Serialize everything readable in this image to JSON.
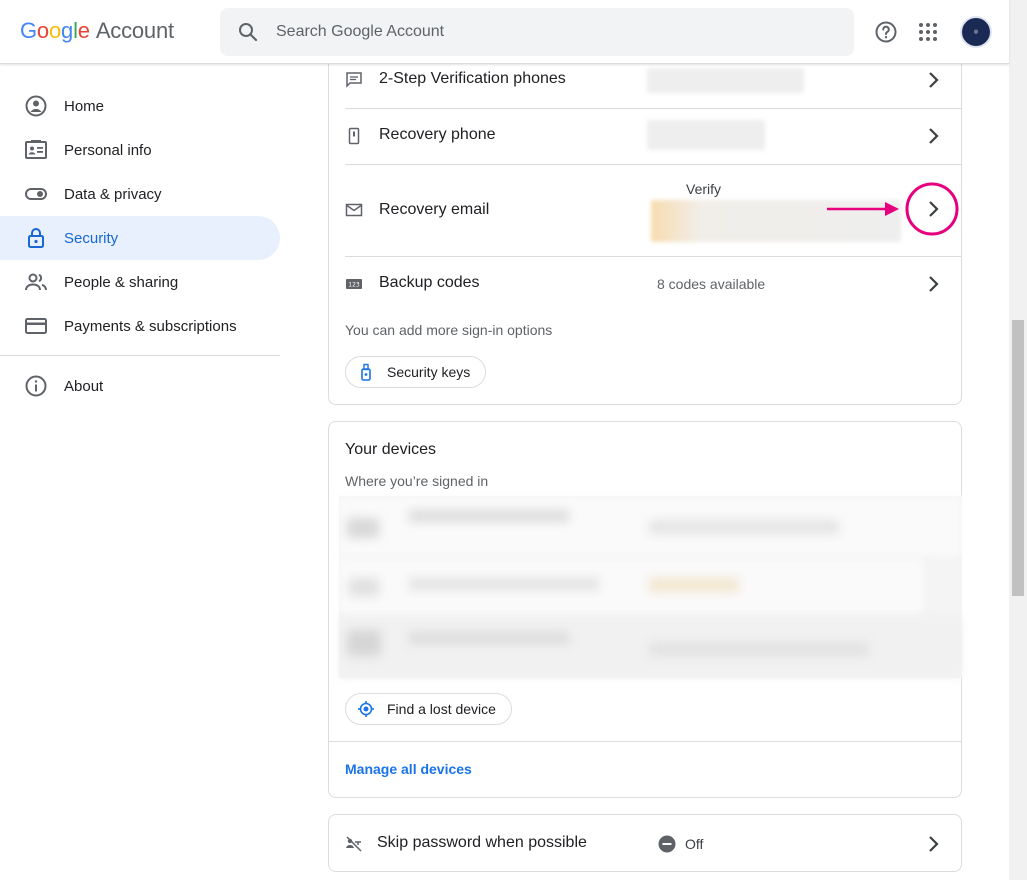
{
  "header": {
    "logo_google": [
      "G",
      "o",
      "o",
      "g",
      "l",
      "e"
    ],
    "logo_account": "Account",
    "search_placeholder": "Search Google Account",
    "help_icon": "help-icon",
    "apps_icon": "apps-grid-icon"
  },
  "sidebar": {
    "items": [
      {
        "label": "Home",
        "icon": "home-icon"
      },
      {
        "label": "Personal info",
        "icon": "id-card-icon"
      },
      {
        "label": "Data & privacy",
        "icon": "toggle-icon"
      },
      {
        "label": "Security",
        "icon": "lock-icon",
        "active": true
      },
      {
        "label": "People & sharing",
        "icon": "people-icon"
      },
      {
        "label": "Payments & subscriptions",
        "icon": "credit-card-icon"
      },
      {
        "label": "About",
        "icon": "info-icon"
      }
    ]
  },
  "signin_card": {
    "rows": [
      {
        "label": "2-Step Verification phones",
        "icon": "message-icon"
      },
      {
        "label": "Recovery phone",
        "icon": "phone-icon"
      },
      {
        "label": "Recovery email",
        "icon": "mail-icon",
        "status": "Verify"
      },
      {
        "label": "Backup codes",
        "icon": "backup-codes-icon",
        "value": "8 codes available"
      }
    ],
    "more_options": "You can add more sign-in options",
    "security_keys_label": "Security keys"
  },
  "devices_card": {
    "title": "Your devices",
    "subtitle": "Where you’re signed in",
    "find_device_label": "Find a lost device",
    "manage_link": "Manage all devices"
  },
  "skip_password_card": {
    "label": "Skip password when possible",
    "status": "Off"
  },
  "colors": {
    "accent": "#1a73e8",
    "active_bg": "#e8f0fe",
    "annotation": "#e6007e"
  }
}
